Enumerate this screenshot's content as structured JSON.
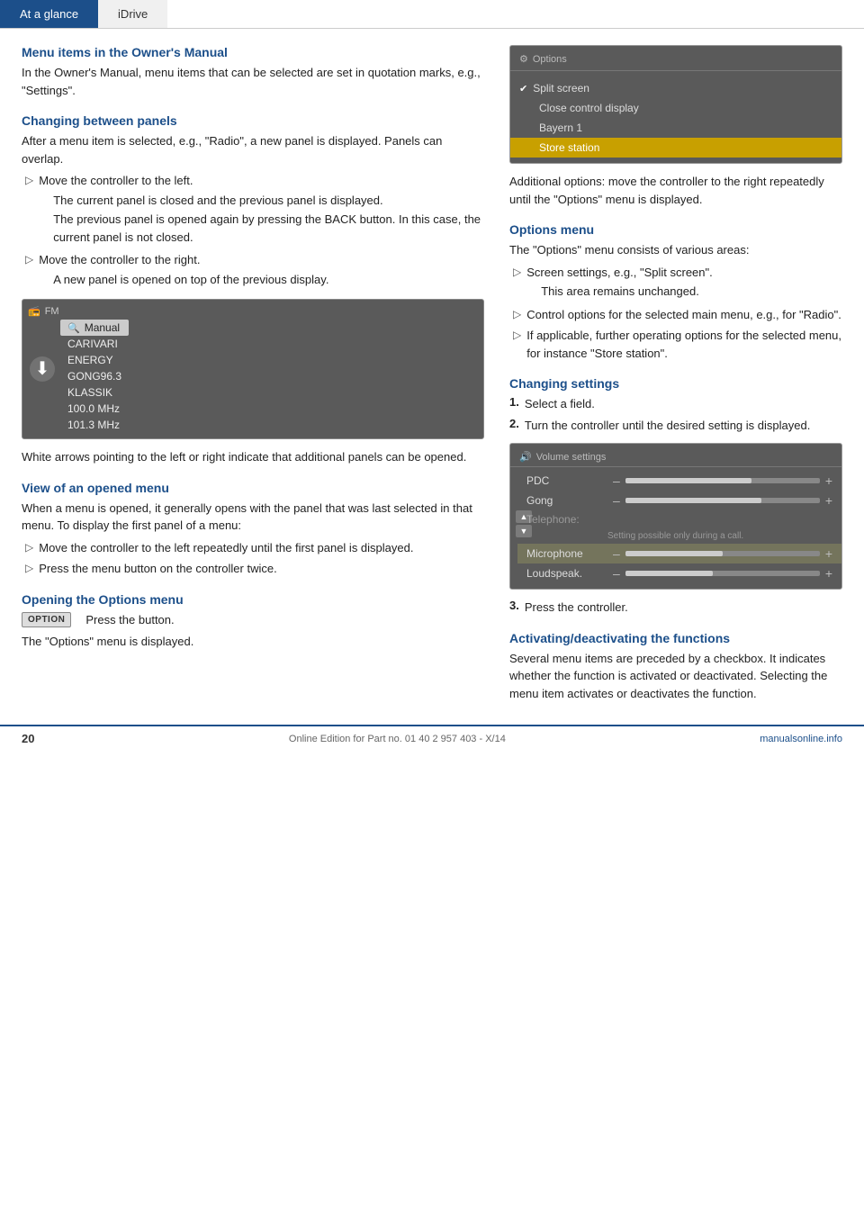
{
  "nav": {
    "tab_active": "At a glance",
    "tab_inactive": "iDrive"
  },
  "left_col": {
    "section1_heading": "Menu items in the Owner's Manual",
    "section1_body": "In the Owner's Manual, menu items that can be selected are set in quotation marks, e.g., \"Settings\".",
    "section2_heading": "Changing between panels",
    "section2_body": "After a menu item is selected, e.g., \"Radio\", a new panel is displayed. Panels can overlap.",
    "bullet1": "Move the controller to the left.",
    "bullet1_sub1": "The current panel is closed and the previous panel is displayed.",
    "bullet1_sub2": "The previous panel is opened again by pressing the BACK button. In this case, the current panel is not closed.",
    "bullet2": "Move the controller to the right.",
    "bullet2_sub1": "A new panel is opened on top of the previous display.",
    "fm_panel_title": "FM",
    "fm_item1": "Manual",
    "fm_item2": "CARIVARI",
    "fm_item3": "ENERGY",
    "fm_item4": "GONG96.3",
    "fm_item5": "KLASSIK",
    "fm_item6": "100.0 MHz",
    "fm_item7": "101.3 MHz",
    "white_arrows_text": "White arrows pointing to the left or right indicate that additional panels can be opened.",
    "section3_heading": "View of an opened menu",
    "section3_body": "When a menu is opened, it generally opens with the panel that was last selected in that menu. To display the first panel of a menu:",
    "bullet3": "Move the controller to the left repeatedly until the first panel is displayed.",
    "bullet4": "Press the menu button on the controller twice.",
    "section4_heading": "Opening the Options menu",
    "press_button_label": "Press the button.",
    "option_btn_label": "OPTION",
    "options_displayed_text": "The \"Options\" menu is displayed."
  },
  "right_col": {
    "options_panel_title": "Options",
    "options_item1_icon": "✔",
    "options_item1": "Split screen",
    "options_item2": "Close control display",
    "options_item3": "Bayern 1",
    "options_item4": "Store station",
    "additional_options_text": "Additional options: move the controller to the right repeatedly until the \"Options\" menu is displayed.",
    "section5_heading": "Options menu",
    "section5_body": "The \"Options\" menu consists of various areas:",
    "options_bullet1": "Screen settings, e.g., \"Split screen\".",
    "options_bullet1_sub": "This area remains unchanged.",
    "options_bullet2": "Control options for the selected main menu, e.g., for \"Radio\".",
    "options_bullet3": "If applicable, further operating options for the selected menu, for instance \"Store station\".",
    "section6_heading": "Changing settings",
    "numbered1": "Select a field.",
    "numbered2": "Turn the controller until the desired setting is displayed.",
    "volume_panel_title": "Volume settings",
    "vol_row1_label": "PDC",
    "vol_row1_pct": 65,
    "vol_row2_label": "Gong",
    "vol_row2_pct": 70,
    "vol_row3_label": "Telephone:",
    "vol_row3_disabled": "Setting possible only during a call.",
    "vol_row4_label": "Microphone",
    "vol_row4_pct": 50,
    "vol_row5_label": "Loudspeak.",
    "vol_row5_pct": 45,
    "numbered3": "Press the controller.",
    "section7_heading": "Activating/deactivating the functions",
    "section7_body": "Several menu items are preceded by a checkbox. It indicates whether the function is activated or deactivated. Selecting the menu item activates or deactivates the function."
  },
  "footer": {
    "page_number": "20",
    "edition_text": "Online Edition for Part no. 01 40 2 957 403 - X/14",
    "brand": "manualsonline.info"
  }
}
